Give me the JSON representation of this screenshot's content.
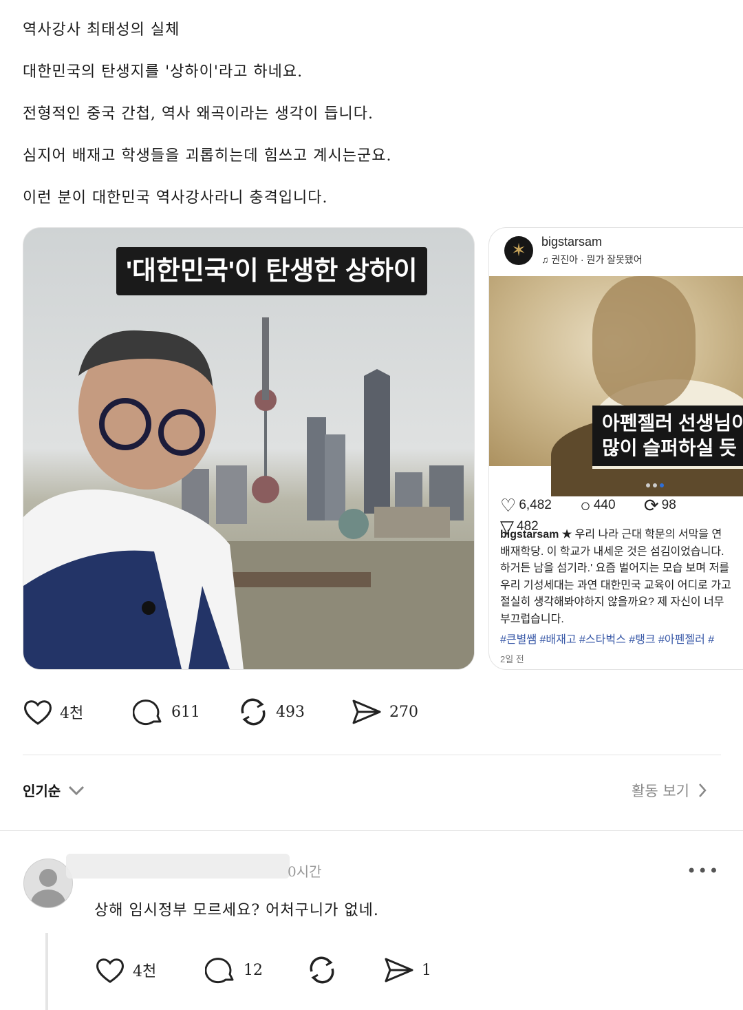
{
  "post": {
    "lines": [
      "역사강사 최태성의 실체",
      "대한민국의 탄생지를 '상하이'라고 하네요.",
      "전형적인 중국 간첩, 역사 왜곡이라는 생각이 듭니다.",
      "심지어 배재고 학생들을 괴롭히는데 힘쓰고 계시는군요.",
      "이런 분이 대한민국 역사강사라니 충격입니다."
    ]
  },
  "media1": {
    "caption": "'대한민국'이 탄생한 상하이"
  },
  "media2": {
    "username": "bigstarsam",
    "music": "권진아 · 뭔가 잘못됐어",
    "overlay": "아펜젤러 선생님이\n많이 슬퍼하실 듯",
    "likes": "6,482",
    "comments": "440",
    "reposts": "98",
    "shares": "482",
    "caption_user": "bigstarsam ★",
    "caption_lines": [
      "우리 나라 근대 학문의 서막을 연",
      "배재학당. 이 학교가 내세운 것은 섬김이었습니다.",
      "하거든 남을 섬기라.' 요즘 벌어지는 모습 보며 저를",
      "우리 기성세대는 과연 대한민국 교육이 어디로 가고",
      "절실히 생각해봐야하지 않을까요? 제 자신이 너무",
      "부끄럽습니다."
    ],
    "hashtags": "#큰별쌤 #배재고 #스타벅스 #탱크 #아펜젤러 #",
    "time": "2일 전"
  },
  "post_actions": {
    "likes": "4천",
    "comments": "611",
    "reposts": "493",
    "shares": "270"
  },
  "sort": {
    "label": "인기순",
    "activity": "활동 보기"
  },
  "comment": {
    "time": "0시간",
    "text": "상해 임시정부 모르세요? 어처구니가 없네.",
    "likes": "4천",
    "comments": "12",
    "shares": "1"
  },
  "colors": {
    "hashtag": "#3a5aa8",
    "dot_active": "#2e6fd8",
    "muted": "#888888"
  }
}
